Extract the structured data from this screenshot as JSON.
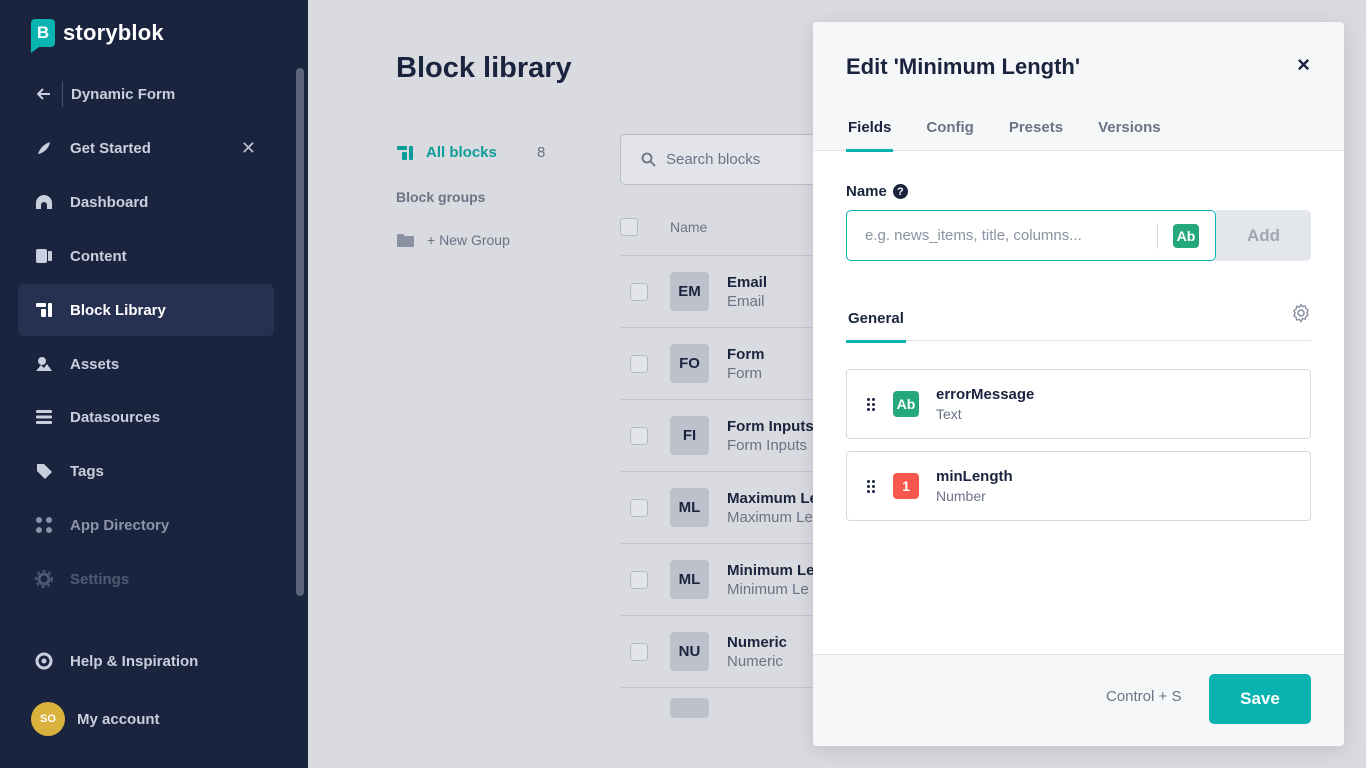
{
  "sidebar": {
    "brand": "storyblok",
    "back_label": "Dynamic Form",
    "items": [
      {
        "label": "Get Started",
        "icon": "rocket-icon"
      },
      {
        "label": "Dashboard",
        "icon": "dashboard-icon"
      },
      {
        "label": "Content",
        "icon": "content-icon"
      },
      {
        "label": "Block Library",
        "icon": "block-library-icon"
      },
      {
        "label": "Assets",
        "icon": "assets-icon"
      },
      {
        "label": "Datasources",
        "icon": "datasources-icon"
      },
      {
        "label": "Tags",
        "icon": "tag-icon"
      },
      {
        "label": "App Directory",
        "icon": "apps-icon"
      },
      {
        "label": "Settings",
        "icon": "gear-icon"
      }
    ],
    "help_label": "Help & Inspiration",
    "account_label": "My account",
    "avatar_initials": "SO"
  },
  "main": {
    "title": "Block library",
    "all_blocks_label": "All blocks",
    "all_blocks_count": "8",
    "groups_title": "Block groups",
    "new_group_label": "+ New Group",
    "search_placeholder": "Search blocks",
    "table_header_name": "Name",
    "rows": [
      {
        "badge": "EM",
        "title": "Email",
        "sub": "Email"
      },
      {
        "badge": "FO",
        "title": "Form",
        "sub": "Form"
      },
      {
        "badge": "FI",
        "title": "Form Inputs",
        "sub": "Form Inputs"
      },
      {
        "badge": "ML",
        "title": "Maximum Le",
        "sub": "Maximum Le"
      },
      {
        "badge": "ML",
        "title": "Minimum Le",
        "sub": "Minimum Le"
      },
      {
        "badge": "NU",
        "title": "Numeric",
        "sub": "Numeric"
      }
    ]
  },
  "modal": {
    "title": "Edit 'Minimum Length'",
    "close": "×",
    "tabs": [
      "Fields",
      "Config",
      "Presets",
      "Versions"
    ],
    "name_label": "Name",
    "help_glyph": "?",
    "name_placeholder": "e.g. news_items, title, columns...",
    "type_chip": "Ab",
    "add_label": "Add",
    "section_tab": "General",
    "fields": [
      {
        "name": "errorMessage",
        "type": "Text",
        "chip": "Ab"
      },
      {
        "name": "minLength",
        "type": "Number",
        "chip": "1"
      }
    ],
    "shortcut": "Control + S",
    "save_label": "Save"
  },
  "colors": {
    "sidebar_bg": "#1b243f",
    "accent": "#09b3af",
    "text_chip": "#26a97a",
    "number_chip": "#f7574c"
  }
}
